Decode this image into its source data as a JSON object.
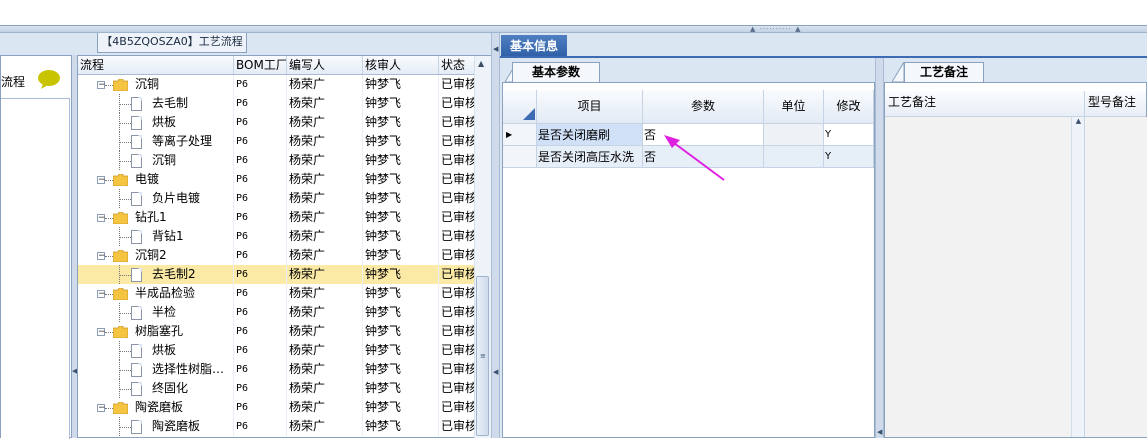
{
  "flow_tab_title": "【4B5ZQOSZA0】工艺流程",
  "left_panel_label": "流程",
  "tree": {
    "columns": [
      "流程",
      "BOM工厂",
      "编写人",
      "核审人",
      "状态"
    ],
    "rows": [
      {
        "name": "沉铜",
        "level": 0,
        "bom": "P6",
        "writer": "杨荣广",
        "reviewer": "钟梦飞",
        "status": "已审核"
      },
      {
        "name": "去毛制",
        "level": 1,
        "bom": "P6",
        "writer": "杨荣广",
        "reviewer": "钟梦飞",
        "status": "已审核"
      },
      {
        "name": "烘板",
        "level": 1,
        "bom": "P6",
        "writer": "杨荣广",
        "reviewer": "钟梦飞",
        "status": "已审核"
      },
      {
        "name": "等离子处理",
        "level": 1,
        "bom": "P6",
        "writer": "杨荣广",
        "reviewer": "钟梦飞",
        "status": "已审核"
      },
      {
        "name": "沉铜",
        "level": 1,
        "bom": "P6",
        "writer": "杨荣广",
        "reviewer": "钟梦飞",
        "status": "已审核"
      },
      {
        "name": "电镀",
        "level": 0,
        "bom": "P6",
        "writer": "杨荣广",
        "reviewer": "钟梦飞",
        "status": "已审核"
      },
      {
        "name": "负片电镀",
        "level": 1,
        "bom": "P6",
        "writer": "杨荣广",
        "reviewer": "钟梦飞",
        "status": "已审核"
      },
      {
        "name": "钻孔1",
        "level": 0,
        "bom": "P6",
        "writer": "杨荣广",
        "reviewer": "钟梦飞",
        "status": "已审核"
      },
      {
        "name": "背钻1",
        "level": 1,
        "bom": "P6",
        "writer": "杨荣广",
        "reviewer": "钟梦飞",
        "status": "已审核"
      },
      {
        "name": "沉铜2",
        "level": 0,
        "bom": "P6",
        "writer": "杨荣广",
        "reviewer": "钟梦飞",
        "status": "已审核"
      },
      {
        "name": "去毛制2",
        "level": 1,
        "bom": "P6",
        "writer": "杨荣广",
        "reviewer": "钟梦飞",
        "status": "已审核",
        "selected": true
      },
      {
        "name": "半成品检验",
        "level": 0,
        "bom": "P6",
        "writer": "杨荣广",
        "reviewer": "钟梦飞",
        "status": "已审核"
      },
      {
        "name": "半检",
        "level": 1,
        "bom": "P6",
        "writer": "杨荣广",
        "reviewer": "钟梦飞",
        "status": "已审核"
      },
      {
        "name": "树脂塞孔",
        "level": 0,
        "bom": "P6",
        "writer": "杨荣广",
        "reviewer": "钟梦飞",
        "status": "已审核"
      },
      {
        "name": "烘板",
        "level": 1,
        "bom": "P6",
        "writer": "杨荣广",
        "reviewer": "钟梦飞",
        "status": "已审核"
      },
      {
        "name": "选择性树脂…",
        "level": 1,
        "bom": "P6",
        "writer": "杨荣广",
        "reviewer": "钟梦飞",
        "status": "已审核"
      },
      {
        "name": "终固化",
        "level": 1,
        "bom": "P6",
        "writer": "杨荣广",
        "reviewer": "钟梦飞",
        "status": "已审核"
      },
      {
        "name": "陶瓷磨板",
        "level": 0,
        "bom": "P6",
        "writer": "杨荣广",
        "reviewer": "钟梦飞",
        "status": "已审核"
      },
      {
        "name": "陶瓷磨板",
        "level": 1,
        "bom": "P6",
        "writer": "杨荣广",
        "reviewer": "钟梦飞",
        "status": "已审核"
      }
    ]
  },
  "info_tab": "基本信息",
  "basic_tab": "基本参数",
  "params": {
    "columns": [
      "项目",
      "参数",
      "单位",
      "修改"
    ],
    "rows": [
      {
        "item": "是否关闭磨刷",
        "value": "否",
        "unit": "",
        "modify": "Y"
      },
      {
        "item": "是否关闭高压水洗",
        "value": "否",
        "unit": "",
        "modify": "Y"
      }
    ]
  },
  "note_tab": "工艺备注",
  "notes": {
    "col1": "工艺备注",
    "col2": "型号备注"
  },
  "colors": {
    "accent": "#3d6cb4",
    "selection": "#fbe9a6",
    "arrow": "#e020e0"
  }
}
